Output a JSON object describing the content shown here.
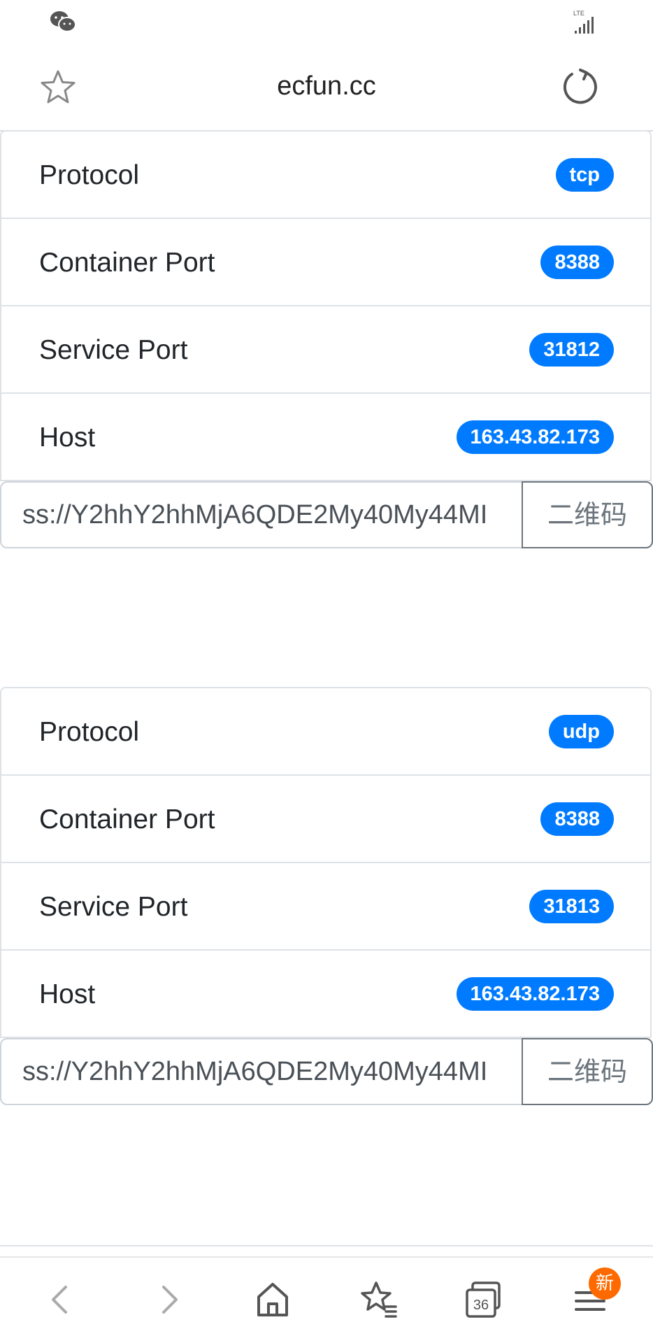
{
  "browser": {
    "url": "ecfun.cc",
    "tab_count": "36",
    "menu_badge": "新"
  },
  "cards": [
    {
      "rows": [
        {
          "label": "Protocol",
          "value": "tcp"
        },
        {
          "label": "Container Port",
          "value": "8388"
        },
        {
          "label": "Service Port",
          "value": "31812"
        },
        {
          "label": "Host",
          "value": "163.43.82.173"
        }
      ],
      "link_value": "ss://Y2hhY2hhMjA6QDE2My40My44MI",
      "qr_label": "二维码"
    },
    {
      "rows": [
        {
          "label": "Protocol",
          "value": "udp"
        },
        {
          "label": "Container Port",
          "value": "8388"
        },
        {
          "label": "Service Port",
          "value": "31813"
        },
        {
          "label": "Host",
          "value": "163.43.82.173"
        }
      ],
      "link_value": "ss://Y2hhY2hhMjA6QDE2My40My44MI",
      "qr_label": "二维码"
    }
  ],
  "colors": {
    "badge": "#007bff",
    "menu_badge": "#ff6a00"
  },
  "icons": [
    "wechat-icon",
    "signal-icon",
    "star-icon",
    "reload-icon",
    "back-icon",
    "forward-icon",
    "home-icon",
    "bookmarks-icon",
    "tabs-icon",
    "menu-icon"
  ]
}
